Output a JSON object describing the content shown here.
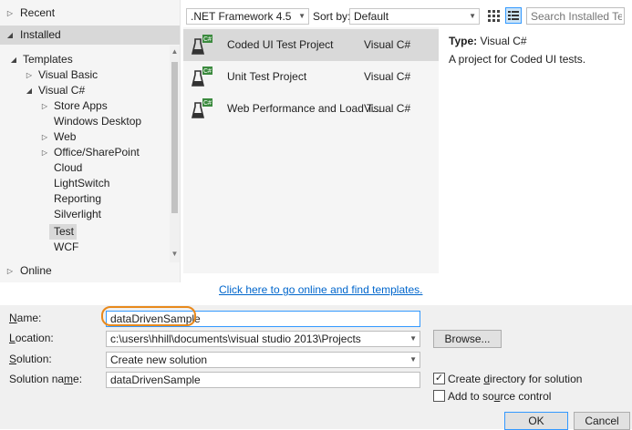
{
  "sidebar": {
    "recent": "Recent",
    "installed": "Installed",
    "templates": "Templates",
    "visual_basic": "Visual Basic",
    "visual_csharp": "Visual C#",
    "items": [
      "Store Apps",
      "Windows Desktop",
      "Web",
      "Office/SharePoint",
      "Cloud",
      "LightSwitch",
      "Reporting",
      "Silverlight",
      "Test",
      "WCF"
    ],
    "online": "Online"
  },
  "toolbar": {
    "framework": ".NET Framework 4.5",
    "sort_by_label": "Sort by:",
    "sort_value": "Default",
    "search_placeholder": "Search Installed Te"
  },
  "templates": [
    {
      "name": "Coded UI Test Project",
      "lang": "Visual C#"
    },
    {
      "name": "Unit Test Project",
      "lang": "Visual C#"
    },
    {
      "name": "Web Performance and Load T...",
      "lang": "Visual C#"
    }
  ],
  "details": {
    "type_label": "Type:",
    "type_value": "Visual C#",
    "description": "A project for Coded UI tests."
  },
  "online_link": "Click here to go online and find templates.",
  "form": {
    "name_label": "Name:",
    "name_value": "dataDrivenSample",
    "location_label": "Location:",
    "location_value": "c:\\users\\hhill\\documents\\visual studio 2013\\Projects",
    "solution_label": "Solution:",
    "solution_value": "Create new solution",
    "solution_name_label": "Solution name:",
    "solution_name_value": "dataDrivenSample",
    "browse": "Browse...",
    "create_dir": "Create directory for solution",
    "add_source": "Add to source control",
    "ok": "OK",
    "cancel": "Cancel"
  },
  "colors": {
    "accent": "#e8891c",
    "link": "#0066cc",
    "selected": "#d9d9d9"
  }
}
